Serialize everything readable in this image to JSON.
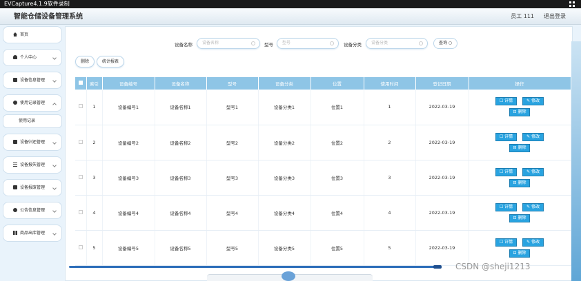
{
  "recorder": {
    "title": "EVCapture4.1.9软件录制"
  },
  "header": {
    "title": "智能仓储设备管理系统",
    "user": "员工 111",
    "logout": "退出登录"
  },
  "sidebar": {
    "items": [
      {
        "label": "首页",
        "icon": "house-icon"
      },
      {
        "label": "个人中心",
        "icon": "user-icon"
      },
      {
        "label": "设备信息管理",
        "icon": "lock-icon"
      },
      {
        "label": "使用记录管理",
        "icon": "bulb-icon"
      },
      {
        "label": "设备归还管理",
        "icon": "lock-icon"
      },
      {
        "label": "设备报失管理",
        "icon": "list-icon"
      },
      {
        "label": "设备报废管理",
        "icon": "lock-icon"
      },
      {
        "label": "公告信息管理",
        "icon": "bulb-icon"
      },
      {
        "label": "商品出库管理",
        "icon": "grid-icon"
      }
    ],
    "sub_item": "使用记录"
  },
  "search": {
    "name_label": "设备名称",
    "name_placeholder": "设备名称",
    "model_label": "型号",
    "model_placeholder": "型号",
    "category_label": "设备分类",
    "category_placeholder": "设备分类",
    "query_label": "查询 ○"
  },
  "actions": {
    "delete": "删除",
    "stats": "统计报表"
  },
  "table": {
    "headers": [
      "索引",
      "设备编号",
      "设备名称",
      "型号",
      "设备分类",
      "位置",
      "使用时间",
      "登记日期",
      "操作"
    ],
    "rows": [
      [
        "1",
        "设备编号1",
        "设备名称1",
        "型号1",
        "设备分类1",
        "位置1",
        "1",
        "2022-03-19"
      ],
      [
        "2",
        "设备编号2",
        "设备名称2",
        "型号2",
        "设备分类2",
        "位置2",
        "2",
        "2022-03-19"
      ],
      [
        "3",
        "设备编号3",
        "设备名称3",
        "型号3",
        "设备分类3",
        "位置3",
        "3",
        "2022-03-19"
      ],
      [
        "4",
        "设备编号4",
        "设备名称4",
        "型号4",
        "设备分类4",
        "位置4",
        "4",
        "2022-03-19"
      ],
      [
        "5",
        "设备编号5",
        "设备名称5",
        "型号5",
        "设备分类5",
        "位置5",
        "5",
        "2022-03-19"
      ]
    ],
    "op_detail": "☐ 详情",
    "op_edit": "✎ 修改",
    "op_delete": "⊟ 删除"
  },
  "watermark": "CSDN @sheji1213",
  "colors": {
    "table_header": "#8ec5e6",
    "op_button": "#29a3e0",
    "accent": "#2f6fba"
  }
}
